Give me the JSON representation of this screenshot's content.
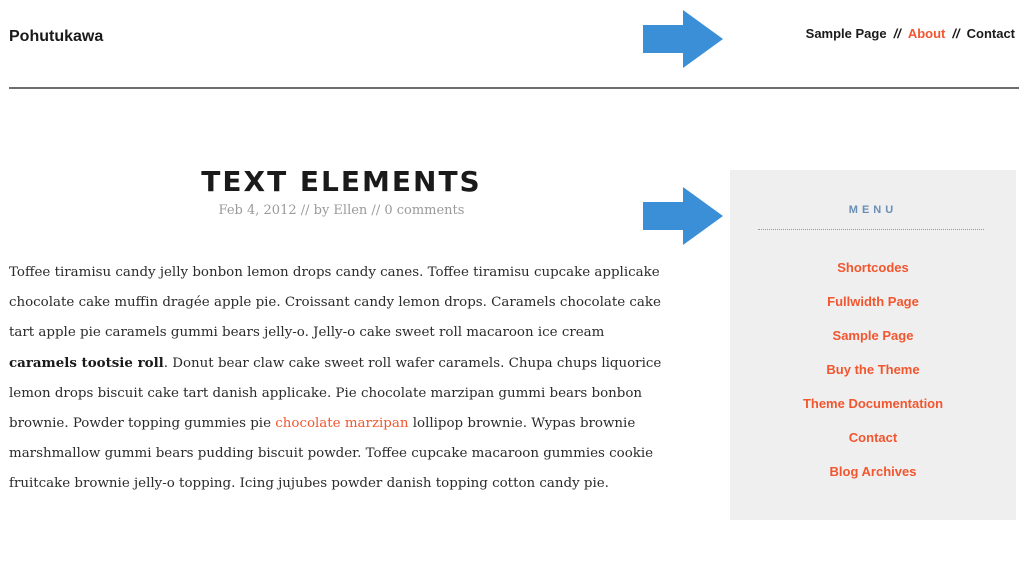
{
  "site": {
    "title": "Pohutukawa"
  },
  "nav": {
    "items": [
      {
        "label": "Sample Page",
        "active": false
      },
      {
        "label": "About",
        "active": true
      },
      {
        "label": "Contact",
        "active": false
      }
    ],
    "separator": "//"
  },
  "post": {
    "title": "TEXT ELEMENTS",
    "meta": "Feb 4, 2012 // by Ellen // 0 comments",
    "body": {
      "p1": "Toffee tiramisu candy jelly bonbon lemon drops candy canes. Toffee tiramisu cupcake applicake chocolate cake muffin dragée apple pie. Croissant candy lemon drops. Caramels chocolate cake tart apple pie caramels gummi bears jelly-o. Jelly-o cake sweet roll macaroon ice cream ",
      "bold": "caramels tootsie roll",
      "p2": ". Donut bear claw cake sweet roll wafer caramels. Chupa chups liquorice lemon drops biscuit cake tart danish applicake. Pie chocolate marzipan gummi bears bonbon brownie. Powder topping gummies pie ",
      "link": "chocolate marzipan",
      "p3": " lollipop brownie. Wypas brownie marshmallow gummi bears pudding biscuit powder. Toffee cupcake macaroon gummies cookie fruitcake brownie jelly-o topping. Icing jujubes powder danish topping cotton candy pie."
    }
  },
  "sidebar": {
    "widget_title": "MENU",
    "items": [
      {
        "label": "Shortcodes"
      },
      {
        "label": "Fullwidth Page"
      },
      {
        "label": "Sample Page"
      },
      {
        "label": "Buy the Theme"
      },
      {
        "label": "Theme Documentation"
      },
      {
        "label": "Contact"
      },
      {
        "label": "Blog Archives"
      }
    ]
  },
  "colors": {
    "accent": "#f2562f",
    "arrow": "#3a8fd6",
    "widget_title": "#6a8fb5",
    "sidebar_bg": "#efefef"
  },
  "icons": {
    "annotation_arrow": "right-arrow-icon"
  }
}
